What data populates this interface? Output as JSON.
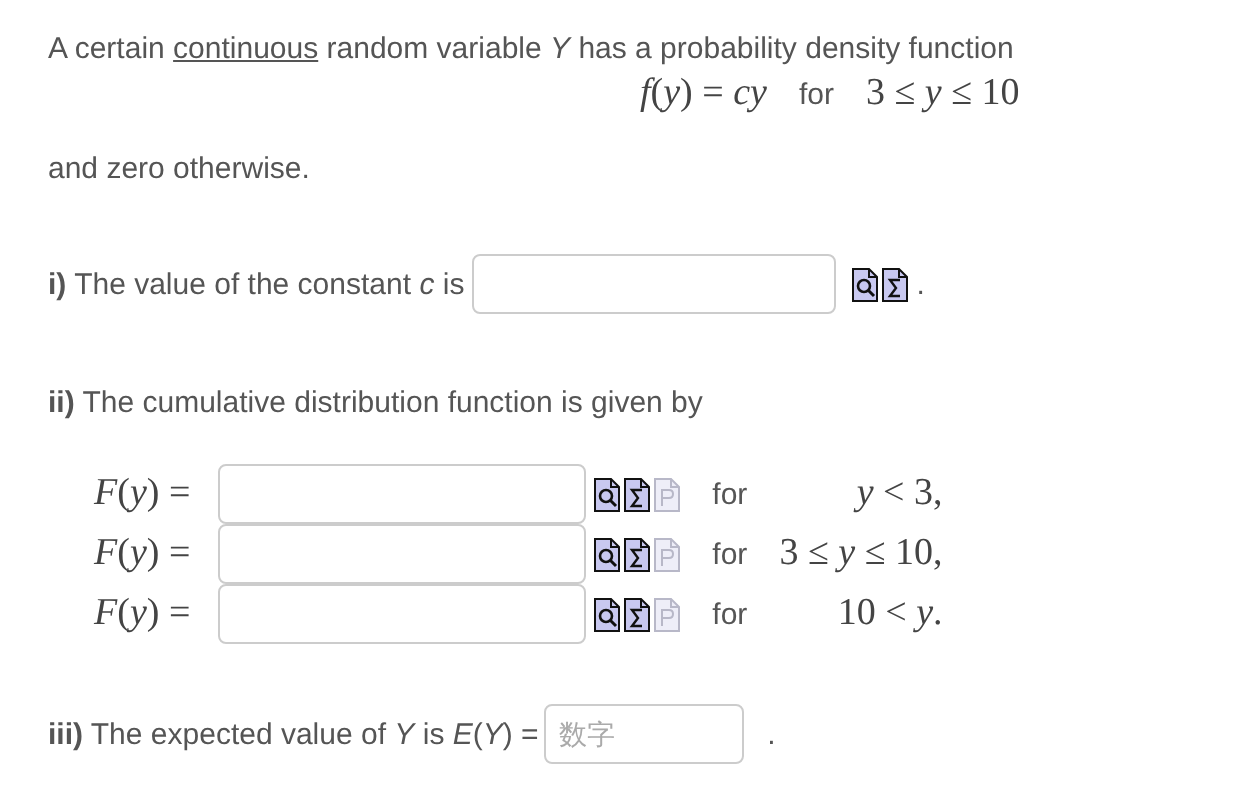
{
  "intro": {
    "before": "A certain ",
    "term": "continuous",
    "after": " random variable *Y* has a probability density function"
  },
  "density": {
    "formula": "*f*(*y*) = *cy*",
    "for": "for",
    "range": "3 ≤ *y* ≤ 10"
  },
  "otherwise": "and zero otherwise.",
  "part_i": {
    "prompt": "**i)** The value of the constant *c* is",
    "tools": [
      {
        "kind": "preview",
        "disabled": false
      },
      {
        "kind": "formula",
        "disabled": false
      }
    ],
    "end": "."
  },
  "part_ii": {
    "prompt": "**ii)** The cumulative distribution function is given by",
    "rows": [
      {
        "lhs": "*F*(*y*) =",
        "tools": [
          {
            "kind": "preview",
            "disabled": false
          },
          {
            "kind": "formula",
            "disabled": false
          },
          {
            "kind": "plot",
            "disabled": true
          }
        ],
        "for": "for",
        "condition": "*y* < 3,"
      },
      {
        "lhs": "*F*(*y*) =",
        "tools": [
          {
            "kind": "preview",
            "disabled": false
          },
          {
            "kind": "formula",
            "disabled": false
          },
          {
            "kind": "plot",
            "disabled": true
          }
        ],
        "for": "for",
        "condition": "3 ≤ *y* ≤ 10,"
      },
      {
        "lhs": "*F*(*y*) =",
        "tools": [
          {
            "kind": "preview",
            "disabled": false
          },
          {
            "kind": "formula",
            "disabled": false
          },
          {
            "kind": "plot",
            "disabled": true
          }
        ],
        "for": "for",
        "condition": "10 < *y*."
      }
    ]
  },
  "part_iii": {
    "prompt": "**iii)** The expected value of *Y* is *E*(*Y*) =",
    "placeholder": "数字",
    "end": "."
  }
}
